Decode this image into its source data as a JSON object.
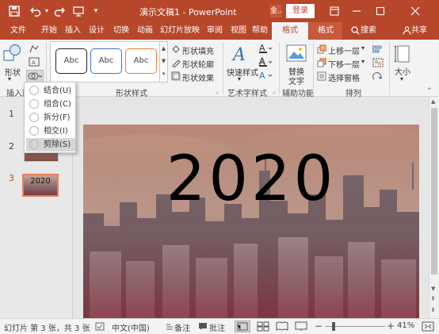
{
  "titlebar": {
    "save_icon": "save-icon",
    "undo_icon": "undo-icon",
    "redo_icon": "redo-icon",
    "present_icon": "present-icon",
    "customize_icon": "chevron-down-icon",
    "doc_title": "演示文稿1 - PowerPoint",
    "user_badge": "金...",
    "login": "登录",
    "minimize_icon": "minimize-icon",
    "maximize_icon": "maximize-icon",
    "close_icon": "close-icon",
    "ribbon_display_icon": "ribbon-display-icon"
  },
  "tabs": [
    "文件",
    "开始",
    "插入",
    "设计",
    "切换",
    "动画",
    "幻灯片放映",
    "审阅",
    "视图",
    "帮助",
    "格式",
    "格式"
  ],
  "search_label": "搜索",
  "share_label": "共享",
  "ribbon": {
    "insert_shape_label": "形状",
    "insert_shape_group": "插入形状",
    "shape_styles_group": "形状样式",
    "abc_label": "Abc",
    "shape_fill": "形状填充",
    "shape_outline": "形状轮廓",
    "shape_effect": "形状效果",
    "quick_style": "快速样式",
    "wordart_group": "艺术字样式",
    "alt_text_1": "替换",
    "alt_text_2": "文字",
    "accessibility_group": "辅助功能",
    "bring_forward": "上移一层",
    "send_backward": "下移一层",
    "selection_pane": "选择窗格",
    "arrange_group": "排列",
    "size_label": "大小",
    "accent": "#b7472a"
  },
  "merge_menu": {
    "items": [
      {
        "label": "结合(U)"
      },
      {
        "label": "组合(C)"
      },
      {
        "label": "拆分(F)"
      },
      {
        "label": "相交(I)"
      },
      {
        "label": "剪除(S)"
      }
    ]
  },
  "thumbnails": [
    {
      "num": "1"
    },
    {
      "num": "2"
    },
    {
      "num": "3",
      "text": "2020"
    }
  ],
  "slide": {
    "text": "2020"
  },
  "status": {
    "slide_info": "幻灯片 第 3 张，共 3 张",
    "language": "中文(中国)",
    "notes": "备注",
    "comments": "批注",
    "zoom": "41%"
  }
}
